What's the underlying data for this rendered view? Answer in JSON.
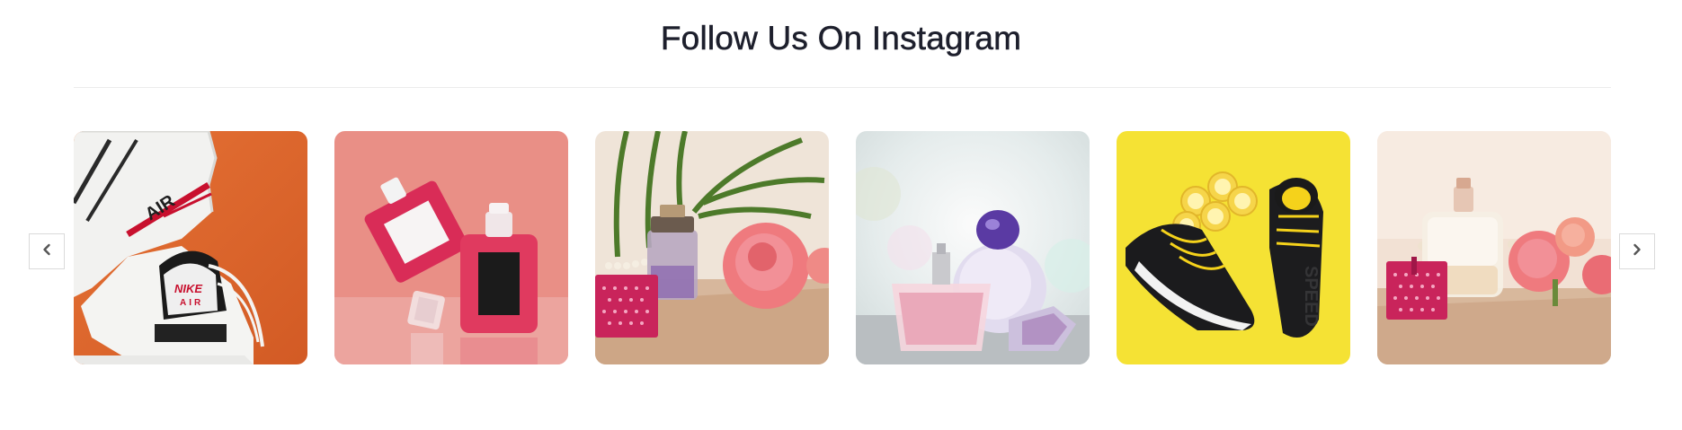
{
  "section": {
    "title": "Follow Us On Instagram"
  },
  "controls": {
    "prev_icon": "chevron-left-icon",
    "next_icon": "chevron-right-icon"
  },
  "gallery": {
    "items": [
      {
        "subject": "white Nike Air sneakers on orange background",
        "background": "#e0652a"
      },
      {
        "subject": "pink perfume bottles on coral background",
        "background": "#e88a82"
      },
      {
        "subject": "perfume bottle with pink rose and palm leaf",
        "background": "#efe6da"
      },
      {
        "subject": "purple perfume bottles on soft blurred background",
        "background": "#e9ecec"
      },
      {
        "subject": "black sneakers with lemons on yellow background",
        "background": "#f5e234"
      },
      {
        "subject": "clear perfume bottle with pink roses and gift box",
        "background": "#f0dfd2"
      }
    ],
    "logo_text": {
      "air": "AIR",
      "nike": "NIKE",
      "air_small": "AIR",
      "speed": "SPEED"
    }
  },
  "colors": {
    "title": "#1d1f2c",
    "divider": "#ececec",
    "arrow_border": "#dadada",
    "arrow_icon": "#555555"
  }
}
